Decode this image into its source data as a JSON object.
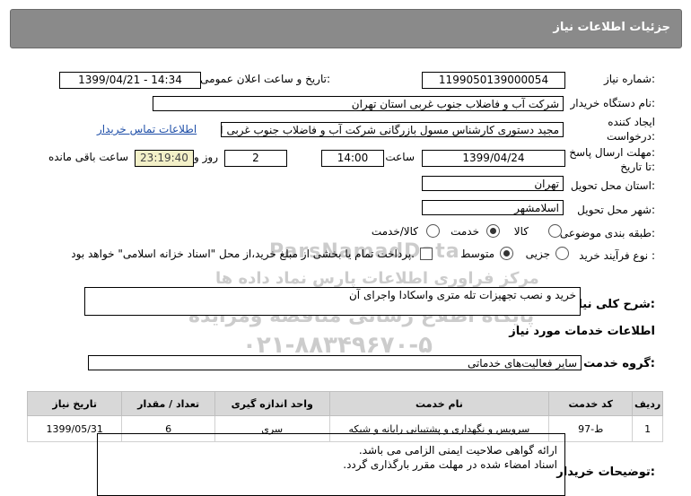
{
  "header": {
    "title": "جزئیات اطلاعات نیاز"
  },
  "form": {
    "need_number_label": "شماره نیاز:",
    "need_number": "1199050139000054",
    "announce_label": "تاریخ و ساعت اعلان عمومی:",
    "announce_value": "1399/04/21 - 14:34",
    "buyer_org_label": "نام دستگاه خریدار:",
    "buyer_org": "شرکت آب و فاضلاب جنوب غربی استان تهران",
    "creator_label_1": "ایجاد کننده",
    "creator_label_2": "درخواست:",
    "creator": "مجید  دستوری  کارشناس مسول بازرگانی  شرکت آب و فاضلاب جنوب غربی اس",
    "contact_link": "اطلاعات تماس خریدار",
    "deadline_label_1": "مهلت ارسال پاسخ:",
    "deadline_label_2": "تا تاریخ:",
    "deadline_date": "1399/04/24",
    "time_label": "ساعت",
    "deadline_time": "14:00",
    "days_value": "2",
    "days_label": "روز و",
    "remaining_time": "23:19:40",
    "remaining_label": "ساعت باقی مانده",
    "province_label": "استان محل تحویل:",
    "province": "تهران",
    "city_label": "شهر محل تحویل:",
    "city": "اسلامشهر",
    "category_label": "طبقه بندی موضوعی:",
    "category_options": [
      "کالا",
      "خدمت",
      "کالا/خدمت"
    ],
    "category_selected": "خدمت",
    "process_label": "نوع فرآیند خرید :",
    "process_options": [
      "جزیی",
      "متوسط"
    ],
    "process_selected": "متوسط",
    "payment_note": "پرداخت تمام یا بخشی از مبلغ خرید،از محل \"اسناد خزانه اسلامی\" خواهد بود."
  },
  "summary": {
    "label": "شرح کلی نیاز:",
    "value": "خرید و نصب تجهیزات تله متری واسکادا واجرای آن"
  },
  "services": {
    "section_title": "اطلاعات خدمات مورد نیاز",
    "group_label": "گروه خدمت:",
    "group_value": "سایر فعالیت‌های خدماتی",
    "columns": [
      "ردیف",
      "کد خدمت",
      "نام خدمت",
      "واحد اندازه گیری",
      "تعداد / مقدار",
      "تاریخ نیاز"
    ],
    "rows": [
      [
        "1",
        "ط-97",
        "سرویس و نگهداری و پشتیبانی رایانه و شبکه",
        "سری",
        "6",
        "1399/05/31"
      ]
    ]
  },
  "buyer_notes": {
    "label": "توضیحات خریدار:",
    "lines": [
      "ارائه گواهی صلاحیت ایمنی الزامی می باشد.",
      "اسناد امضاء شده در مهلت مقرر بارگذاری گردد."
    ]
  },
  "watermark": {
    "line1": "ParsNamadData",
    "line2": "مرکز فراوری اطلاعات پارس نماد داده ها",
    "line3": "پایگاه اطلاع رسانی مناقصه ومزایده",
    "line4": "۰۲۱-۸۸۳۴۹۶۷۰-۵"
  },
  "colors": {
    "header_bg": "#8a8a8a",
    "link": "#1f4fa8",
    "timer_bg": "#f3f0c8"
  }
}
